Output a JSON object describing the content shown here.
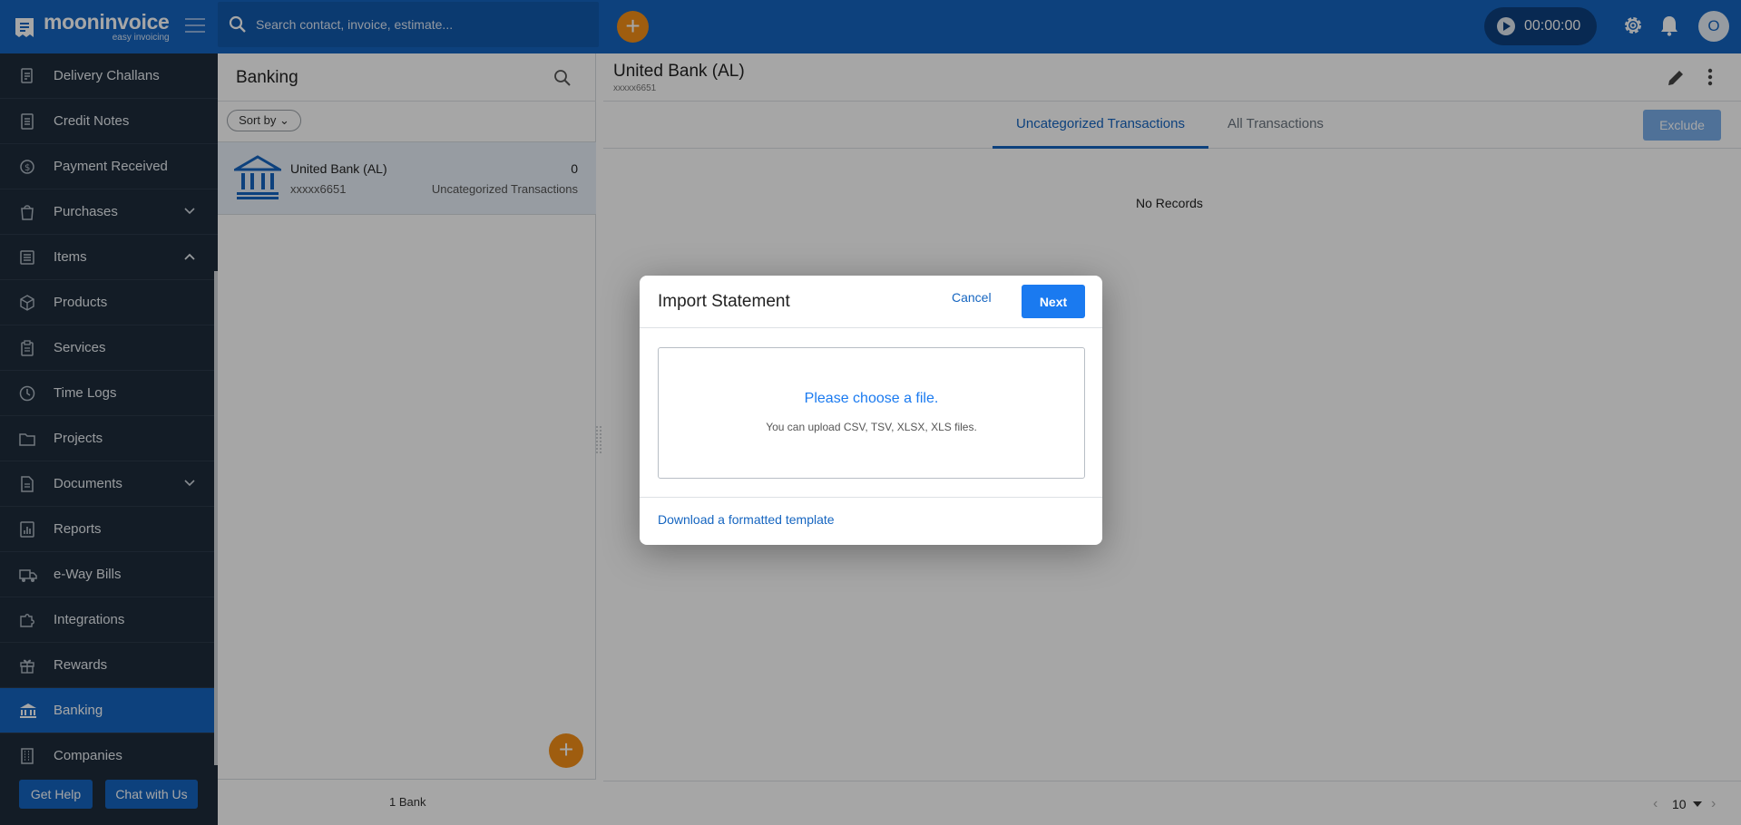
{
  "app": {
    "brand_name": "mooninvoice",
    "brand_tagline": "easy invoicing",
    "search_placeholder": "Search contact, invoice, estimate...",
    "timer": "00:00:00",
    "avatar_initial": "O",
    "accent_color": "#1565c0",
    "fab_color": "#f58f17"
  },
  "sidebar": {
    "items": [
      {
        "label": "Delivery Challans",
        "icon": "delivery-challan-icon"
      },
      {
        "label": "Credit Notes",
        "icon": "credit-note-icon"
      },
      {
        "label": "Payment Received",
        "icon": "payment-received-icon"
      },
      {
        "label": "Purchases",
        "icon": "purchases-icon",
        "chevron": "down"
      },
      {
        "label": "Items",
        "icon": "items-icon",
        "chevron": "up"
      },
      {
        "label": "Products",
        "icon": "products-icon"
      },
      {
        "label": "Services",
        "icon": "services-icon"
      },
      {
        "label": "Time Logs",
        "icon": "clock-icon"
      },
      {
        "label": "Projects",
        "icon": "folder-icon"
      },
      {
        "label": "Documents",
        "icon": "document-icon",
        "chevron": "down"
      },
      {
        "label": "Reports",
        "icon": "reports-icon"
      },
      {
        "label": "e-Way Bills",
        "icon": "truck-icon"
      },
      {
        "label": "Integrations",
        "icon": "puzzle-icon"
      },
      {
        "label": "Rewards",
        "icon": "gift-icon"
      },
      {
        "label": "Banking",
        "icon": "bank-icon",
        "active": true
      },
      {
        "label": "Companies",
        "icon": "building-icon"
      }
    ],
    "get_help": "Get Help",
    "chat_with_us": "Chat with Us"
  },
  "banking": {
    "title": "Banking",
    "sort_label": "Sort by",
    "accounts": [
      {
        "name": "United Bank (AL)",
        "account": "xxxxx6651",
        "count": "0",
        "subtitle": "Uncategorized Transactions"
      }
    ],
    "footer": "1 Bank"
  },
  "detail": {
    "title": "United Bank (AL)",
    "account": "xxxxx6651",
    "tabs": [
      {
        "label": "Uncategorized Transactions",
        "active": true
      },
      {
        "label": "All Transactions",
        "active": false
      }
    ],
    "exclude_label": "Exclude",
    "empty_text": "No Records",
    "page_size": "10"
  },
  "modal": {
    "title": "Import Statement",
    "cancel": "Cancel",
    "next": "Next",
    "drop_title": "Please choose a file.",
    "drop_subtitle": "You can upload CSV, TSV, XLSX, XLS files.",
    "template_link": "Download a formatted template"
  }
}
